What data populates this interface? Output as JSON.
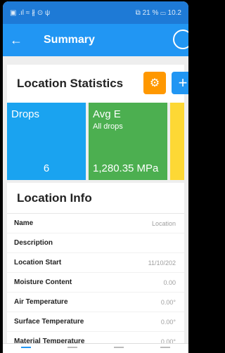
{
  "statusbar": {
    "left": "▣ .ıl ≈ ∦ ⊙ ψ",
    "right": "⧉ 21 % ▭ 10.2"
  },
  "appbar": {
    "title": "Summary",
    "back_icon": "arrow-left-icon",
    "profile_icon": "profile-icon"
  },
  "stats": {
    "title": "Location Statistics",
    "gear_icon": "gear-icon",
    "add_icon": "plus-icon",
    "tiles": [
      {
        "label": "Drops",
        "sub": "",
        "value": "6",
        "color": "#1aa3f0"
      },
      {
        "label": "Avg E",
        "sub": "All drops",
        "value": "1,280.35 MPa",
        "color": "#4caf50"
      }
    ]
  },
  "info": {
    "title": "Location Info",
    "rows": [
      {
        "label": "Name",
        "value": "Location"
      },
      {
        "label": "Description",
        "value": ""
      },
      {
        "label": "Location Start",
        "value": "11/10/202"
      },
      {
        "label": "Moisture Content",
        "value": "0.00"
      },
      {
        "label": "Air Temperature",
        "value": "0.00°"
      },
      {
        "label": "Surface Temperature",
        "value": "0.00°"
      },
      {
        "label": "Material Temperature",
        "value": "0.00°"
      }
    ]
  }
}
